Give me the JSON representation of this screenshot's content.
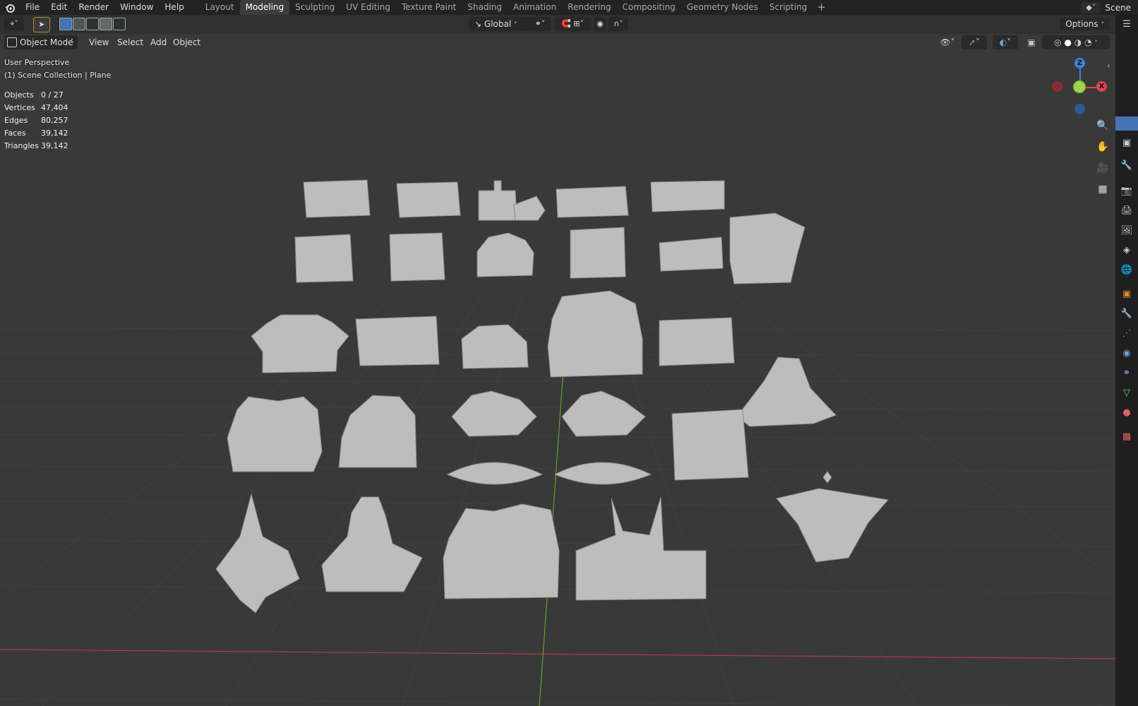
{
  "app": {
    "logo_icon": "blender-logo-icon"
  },
  "menu": {
    "items": [
      "File",
      "Edit",
      "Render",
      "Window",
      "Help"
    ]
  },
  "workspaces": {
    "tabs": [
      "Layout",
      "Modeling",
      "Sculpting",
      "UV Editing",
      "Texture Paint",
      "Shading",
      "Animation",
      "Rendering",
      "Compositing",
      "Geometry Nodes",
      "Scripting"
    ],
    "active": "Modeling",
    "add_symbol": "+"
  },
  "scene": {
    "name": "Scene"
  },
  "toolbar": {
    "orientation": "Global",
    "options_label": "Options"
  },
  "viewport_header": {
    "mode": "Object Mode",
    "menus": [
      "View",
      "Select",
      "Add",
      "Object"
    ]
  },
  "overlay": {
    "perspective": "User Perspective",
    "collection": "(1) Scene Collection | Plane",
    "stats": [
      {
        "label": "Objects",
        "value": "0 / 27"
      },
      {
        "label": "Vertices",
        "value": "47,404"
      },
      {
        "label": "Edges",
        "value": "80,257"
      },
      {
        "label": "Faces",
        "value": "39,142"
      },
      {
        "label": "Triangles",
        "value": "39,142"
      }
    ]
  },
  "gizmo": {
    "x_label": "X",
    "y_label": "Y",
    "z_label": "Z",
    "colors": {
      "x": "#e2414e",
      "y": "#8bc638",
      "z": "#3e82d8"
    }
  },
  "colors": {
    "accent": "#4772b3",
    "bg": "#393939",
    "header": "#232323"
  }
}
